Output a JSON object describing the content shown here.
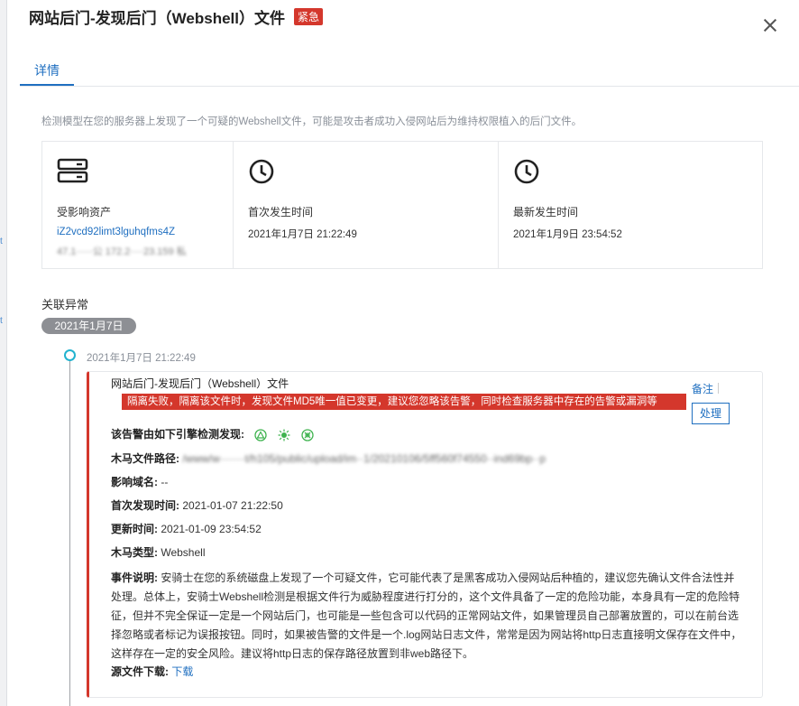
{
  "header": {
    "title": "网站后门-发现后门（Webshell）文件",
    "severity": "紧急"
  },
  "tabs": [
    {
      "label": "详情"
    }
  ],
  "description": "检测模型在您的服务器上发现了一个可疑的Webshell文件，可能是攻击者成功入侵网站后为维持权限植入的后门文件。",
  "cards": {
    "asset": {
      "label": "受影响资产",
      "value": "iZ2vcd92limt3lguhqfms4Z",
      "ip_masked": "47.1·····公  172.2····23.159 私"
    },
    "first": {
      "label": "首次发生时间",
      "value": "2021年1月7日 21:22:49"
    },
    "latest": {
      "label": "最新发生时间",
      "value": "2021年1月9日 23:54:52"
    }
  },
  "assoc": {
    "title": "关联异常",
    "date": "2021年1月7日",
    "time": "2021年1月7日 21:22:49"
  },
  "event": {
    "title": "网站后门-发现后门（Webshell）文件",
    "alert": "隔离失败，隔离该文件时，发现文件MD5唯一值已变更，建议您忽略该告警，同时检查服务器中存在的告警或漏洞等",
    "note_label": "备注",
    "process_label": "处理",
    "engine_label": "该告警由如下引擎检测发现:",
    "trojan_path_label": "木马文件路径:",
    "trojan_path_value": "/www/w·······t/h105/public/upload/im··1/20210106/5ff560f74550··ind69bp··p",
    "domain_label": "影响域名:",
    "domain_value": "--",
    "first_found_label": "首次发现时间:",
    "first_found_value": "2021-01-07 21:22:50",
    "update_label": "更新时间:",
    "update_value": "2021-01-09 23:54:52",
    "type_label": "木马类型:",
    "type_value": "Webshell",
    "explain_label": "事件说明:",
    "explain_value": "安骑士在您的系统磁盘上发现了一个可疑文件，它可能代表了是黑客成功入侵网站后种植的，建议您先确认文件合法性并处理。总体上，安骑士Webshell检测是根据文件行为威胁程度进行打分的，这个文件具备了一定的危险功能，本身具有一定的危险特征，但并不完全保证一定是一个网站后门，也可能是一些包含可以代码的正常网站文件，如果管理员自己部署放置的，可以在前台选择忽略或者标记为误报按钮。同时，如果被告警的文件是一个.log网站日志文件，常常是因为网站将http日志直接明文保存在文件中，这样存在一定的安全风险。建议将http日志的保存路径放置到非web路径下。",
    "source_label": "源文件下载:",
    "source_link": "下载"
  },
  "colors": {
    "accent": "#1f6fc0",
    "danger": "#d4372c",
    "timeline": "#22b3cf",
    "engine_icons": "#3fb34f"
  }
}
